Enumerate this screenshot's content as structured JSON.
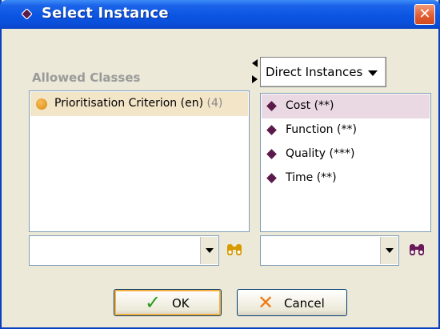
{
  "window": {
    "title": "Select Instance",
    "close_glyph": "✕"
  },
  "left_panel": {
    "heading": "Allowed Classes",
    "items": [
      {
        "label": "Prioritisation Criterion (en)",
        "count": "(4)",
        "icon": "orange-class-dot-icon",
        "color": "#e2961a"
      }
    ],
    "search_value": ""
  },
  "right_panel": {
    "view_selector": {
      "selected": "Direct Instances"
    },
    "items": [
      {
        "label": "Cost (**)",
        "selected": true,
        "icon": "instance-diamond-icon"
      },
      {
        "label": "Function (**)",
        "selected": false,
        "icon": "instance-diamond-icon"
      },
      {
        "label": "Quality (***)",
        "selected": false,
        "icon": "instance-diamond-icon"
      },
      {
        "label": "Time (**)",
        "selected": false,
        "icon": "instance-diamond-icon"
      }
    ],
    "search_value": "",
    "diamond_color": "#5b1a4a"
  },
  "buttons": {
    "ok": "OK",
    "cancel": "Cancel"
  },
  "colors": {
    "title_bar": "#0b55e3",
    "selection_left": "#f3e5c8",
    "selection_right": "#ead8e2"
  }
}
